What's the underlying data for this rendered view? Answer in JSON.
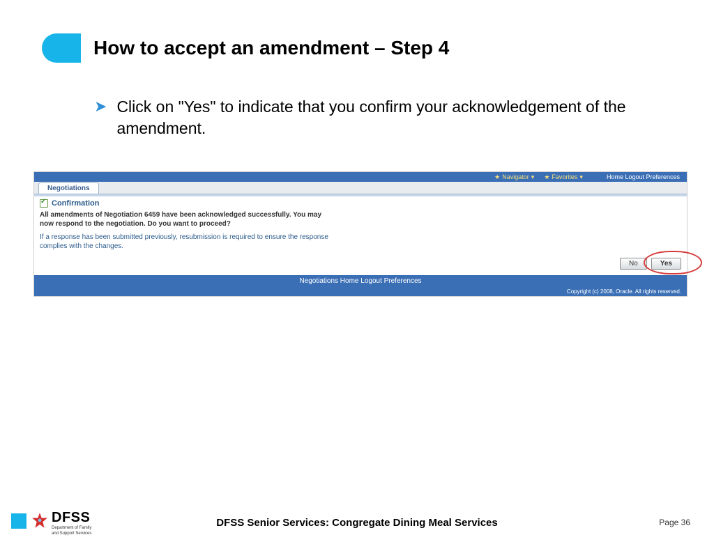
{
  "title": "How to accept an amendment – Step 4",
  "bullet": "Click on \"Yes\" to indicate that you confirm your acknowledgement of the amendment.",
  "topnav": {
    "navigator": "Navigator",
    "favorites": "Favorites",
    "links": "Home  Logout  Preferences"
  },
  "tab": "Negotiations",
  "confirmation": {
    "label": "Confirmation",
    "main": "All amendments of Negotiation 6459 have been acknowledged successfully. You may now respond to the negotiation. Do you want to proceed?",
    "note": "If a response has been submitted previously, resubmission is required to ensure the response complies with the changes."
  },
  "buttons": {
    "no": "No",
    "yes": "Yes"
  },
  "footerlinks": "Negotiations   Home   Logout   Preferences",
  "copyright": "Copyright (c) 2008, Oracle. All rights reserved.",
  "logo": {
    "big": "DFSS",
    "small1": "Department of Family",
    "small2": "and Support Services"
  },
  "footer_title": "DFSS Senior Services: Congregate Dining Meal Services",
  "page": "Page 36"
}
